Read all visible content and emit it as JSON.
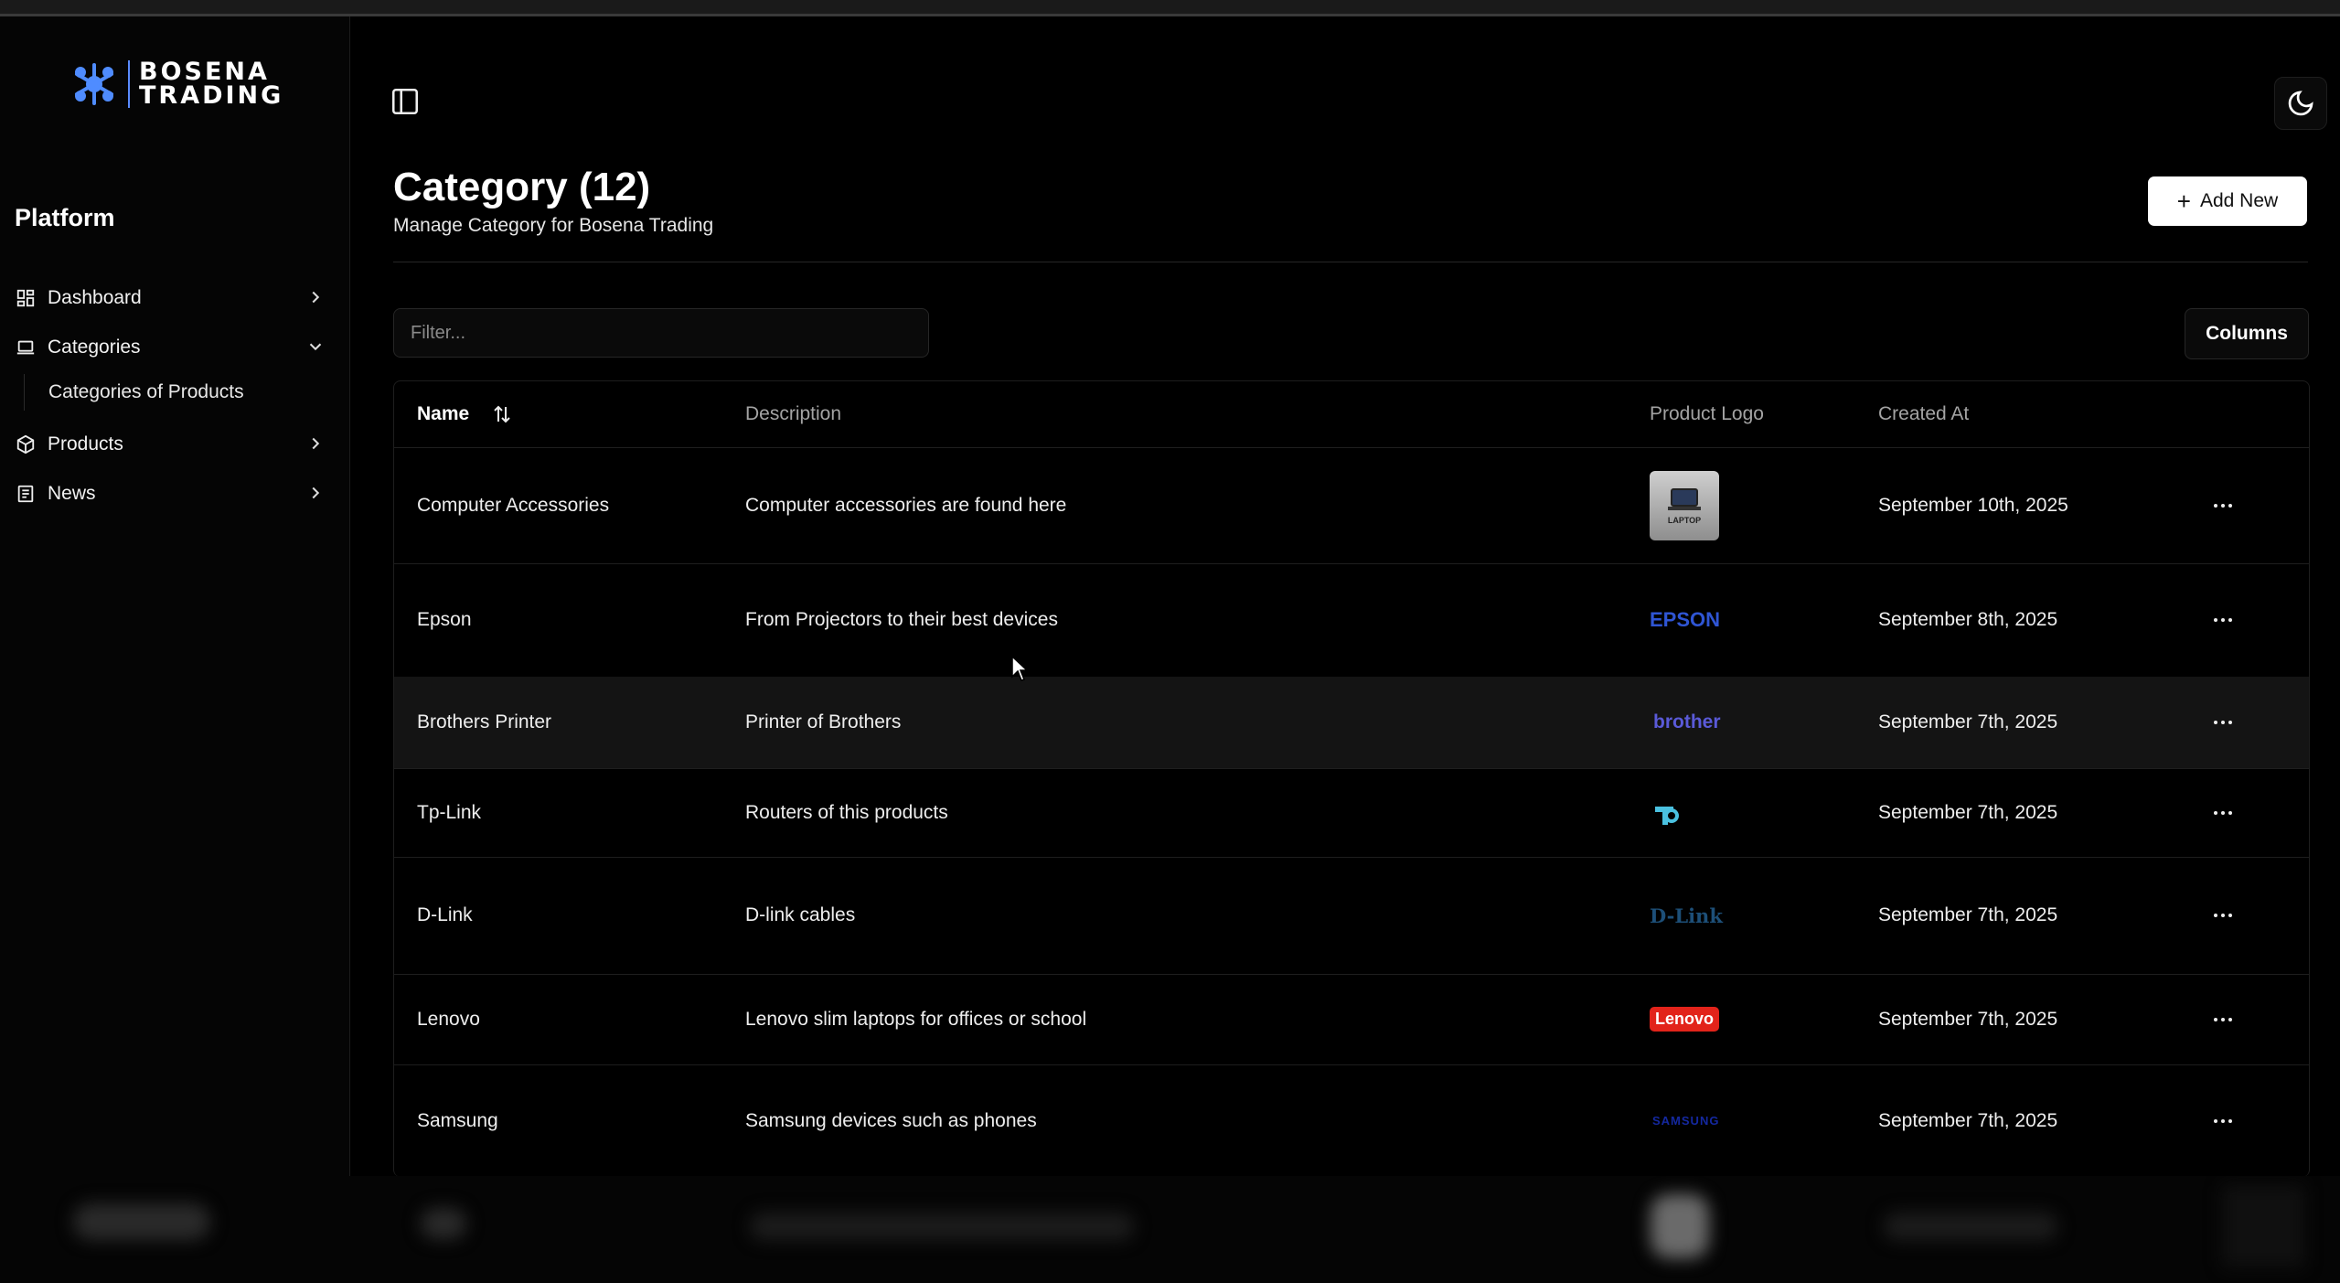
{
  "brand": {
    "line1": "BOSENA",
    "line2": "TRADING",
    "accent": "#4f8cff"
  },
  "sidebar": {
    "section_title": "Platform",
    "items": [
      {
        "label": "Dashboard",
        "icon": "dashboard-icon"
      },
      {
        "label": "Categories",
        "icon": "laptop-icon"
      },
      {
        "label": "Products",
        "icon": "package-icon"
      },
      {
        "label": "News",
        "icon": "newspaper-icon"
      }
    ],
    "sub_items": [
      {
        "label": "Categories of Products"
      }
    ]
  },
  "header": {
    "title": "Category (12)",
    "subtitle": "Manage Category for Bosena Trading",
    "add_button": "Add New"
  },
  "toolbar": {
    "filter_placeholder": "Filter...",
    "columns_button": "Columns"
  },
  "table": {
    "columns": [
      "Name",
      "Description",
      "Product Logo",
      "Created At"
    ],
    "rows": [
      {
        "name": "Computer Accessories",
        "description": "Computer accessories are found here",
        "logo": "LAPTOP",
        "created": "September 10th, 2025"
      },
      {
        "name": "Epson",
        "description": "From Projectors to their best devices",
        "logo": "EPSON",
        "created": "September 8th, 2025"
      },
      {
        "name": "Brothers Printer",
        "description": "Printer of Brothers",
        "logo": "brother",
        "created": "September 7th, 2025"
      },
      {
        "name": "Tp-Link",
        "description": "Routers of this products",
        "logo": "tp-link-logo-icon",
        "created": "September 7th, 2025"
      },
      {
        "name": "D-Link",
        "description": "D-link cables",
        "logo": "D-Link",
        "created": "September 7th, 2025"
      },
      {
        "name": "Lenovo",
        "description": "Lenovo slim laptops for offices or school",
        "logo": "Lenovo",
        "created": "September 7th, 2025"
      },
      {
        "name": "Samsung",
        "description": "Samsung devices such as phones",
        "logo": "SAMSUNG",
        "created": "September 7th, 2025"
      }
    ]
  },
  "colors": {
    "epson": "#2f55d4",
    "brother": "#5a5ad8",
    "dlink": "#1d4f78",
    "lenovo": "#e2231a",
    "samsung": "#1428a0",
    "tplink": "#4ac1e0"
  }
}
